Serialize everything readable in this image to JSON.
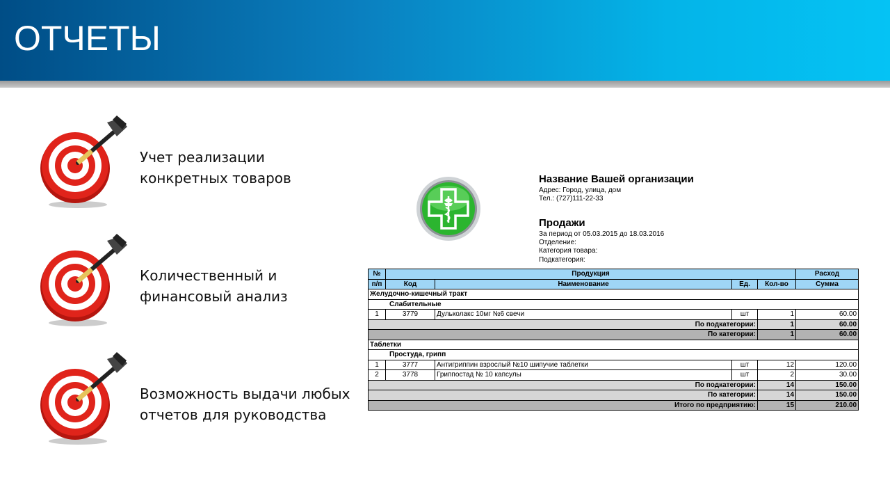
{
  "header": {
    "title": "ОТЧЕТЫ"
  },
  "features": [
    {
      "line1": "Учет реализации",
      "line2": "конкретных товаров"
    },
    {
      "line1": "Количественный и",
      "line2": "финансовый анализ"
    },
    {
      "line1": "Возможность выдачи любых",
      "line2": "отчетов для руководства"
    }
  ],
  "icons": {
    "feature_icon": "target-dart-icon",
    "logo": "pharmacy-cross-icon"
  },
  "colors": {
    "header_dark": "#004d86",
    "header_light": "#05c3f4",
    "table_header": "#9fd6f6",
    "target_red": "#d8231c",
    "logo_green": "#2bb52f"
  },
  "report": {
    "org_name": "Название Вашей организации",
    "address": "Адрес: Город, улица, дом",
    "phone": "Тел.: (727)111-22-33",
    "title": "Продажи",
    "period": "За период от 05.03.2015 до 18.03.2016",
    "department": "Отделение:",
    "product_category": "Категория товара:",
    "subcategory": "Подкатегория:",
    "columns": {
      "num_top": "№",
      "num_bottom": "п/п",
      "products": "Продукция",
      "expense": "Расход",
      "code": "Код",
      "name": "Наименование",
      "unit": "Ед.",
      "qty": "Кол-во",
      "sum": "Сумма"
    },
    "groups": [
      {
        "category": "Желудочно-кишечный тракт",
        "subcategory": "Слабительные",
        "rows": [
          {
            "n": "1",
            "code": "3779",
            "name": "Дульколакс 10мг №6 свечи",
            "unit": "шт",
            "qty": "1",
            "sum": "60.00"
          }
        ],
        "sub_total_label": "По подкатегории:",
        "sub_total_qty": "1",
        "sub_total_sum": "60.00",
        "cat_total_label": "По категории:",
        "cat_total_qty": "1",
        "cat_total_sum": "60.00"
      },
      {
        "category": "Таблетки",
        "subcategory": "Простуда, грипп",
        "rows": [
          {
            "n": "1",
            "code": "3777",
            "name": "Антигриппин взрослый №10 шипучие таблетки",
            "unit": "шт",
            "qty": "12",
            "sum": "120.00"
          },
          {
            "n": "2",
            "code": "3778",
            "name": "Гриппостад № 10 капсулы",
            "unit": "шт",
            "qty": "2",
            "sum": "30.00"
          }
        ],
        "sub_total_label": "По подкатегории:",
        "sub_total_qty": "14",
        "sub_total_sum": "150.00",
        "cat_total_label": "По категории:",
        "cat_total_qty": "14",
        "cat_total_sum": "150.00"
      }
    ],
    "grand_total_label": "Итого по предприятию:",
    "grand_total_qty": "15",
    "grand_total_sum": "210.00"
  }
}
